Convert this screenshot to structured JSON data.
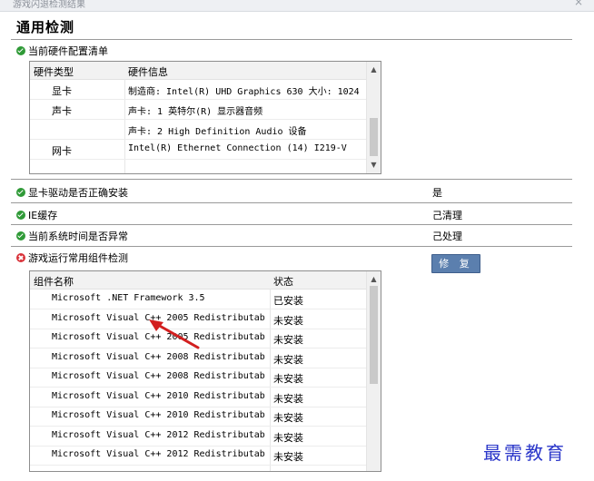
{
  "window": {
    "title": "游戏闪退检测结果",
    "close_glyph": "×"
  },
  "heading": "通用检测",
  "hardware": {
    "label": "当前硬件配置清单",
    "columns": [
      "硬件类型",
      "硬件信息"
    ],
    "rows": [
      {
        "type": "显卡",
        "info": "制造商: Intel(R) UHD Graphics 630 大小: 1024"
      },
      {
        "type": "声卡",
        "info": "声卡: 1 英特尔(R) 显示器音频"
      },
      {
        "type": "",
        "info": "声卡: 2 High Definition Audio 设备"
      },
      {
        "type": "网卡",
        "info": "Intel(R) Ethernet Connection (14) I219-V"
      }
    ]
  },
  "checks": [
    {
      "label": "显卡驱动是否正确安装",
      "status": "ok",
      "value": "是"
    },
    {
      "label": "IE缓存",
      "status": "ok",
      "value": "己清理"
    },
    {
      "label": "当前系统时间是否异常",
      "status": "ok",
      "value": "己处理"
    }
  ],
  "components": {
    "label": "游戏运行常用组件检测",
    "status": "error",
    "repair_label": "修 复",
    "columns": [
      "组件名称",
      "状态"
    ],
    "rows": [
      {
        "name": "Microsoft .NET Framework 3.5",
        "state": "已安装"
      },
      {
        "name": "Microsoft Visual C++ 2005 Redistributab",
        "state": "未安装"
      },
      {
        "name": "Microsoft Visual C++ 2005 Redistributab",
        "state": "未安装"
      },
      {
        "name": "Microsoft Visual C++ 2008 Redistributab",
        "state": "未安装"
      },
      {
        "name": "Microsoft Visual C++ 2008 Redistributab",
        "state": "未安装"
      },
      {
        "name": "Microsoft Visual C++ 2010 Redistributab",
        "state": "未安装"
      },
      {
        "name": "Microsoft Visual C++ 2010 Redistributab",
        "state": "未安装"
      },
      {
        "name": "Microsoft Visual C++ 2012 Redistributab",
        "state": "未安装"
      },
      {
        "name": "Microsoft Visual C++ 2012 Redistributab",
        "state": "未安装"
      }
    ]
  },
  "watermark": "最需教育",
  "colors": {
    "ok": "#2f9a37",
    "error": "#d9333a",
    "repair_button": "#5b7fae",
    "watermark": "#2a36c9",
    "arrow": "#d21f1f"
  },
  "icons": {
    "ok": "check-circle-icon",
    "error": "x-circle-icon",
    "scroll_up": "chevron-up-icon",
    "scroll_down": "chevron-down-icon"
  }
}
